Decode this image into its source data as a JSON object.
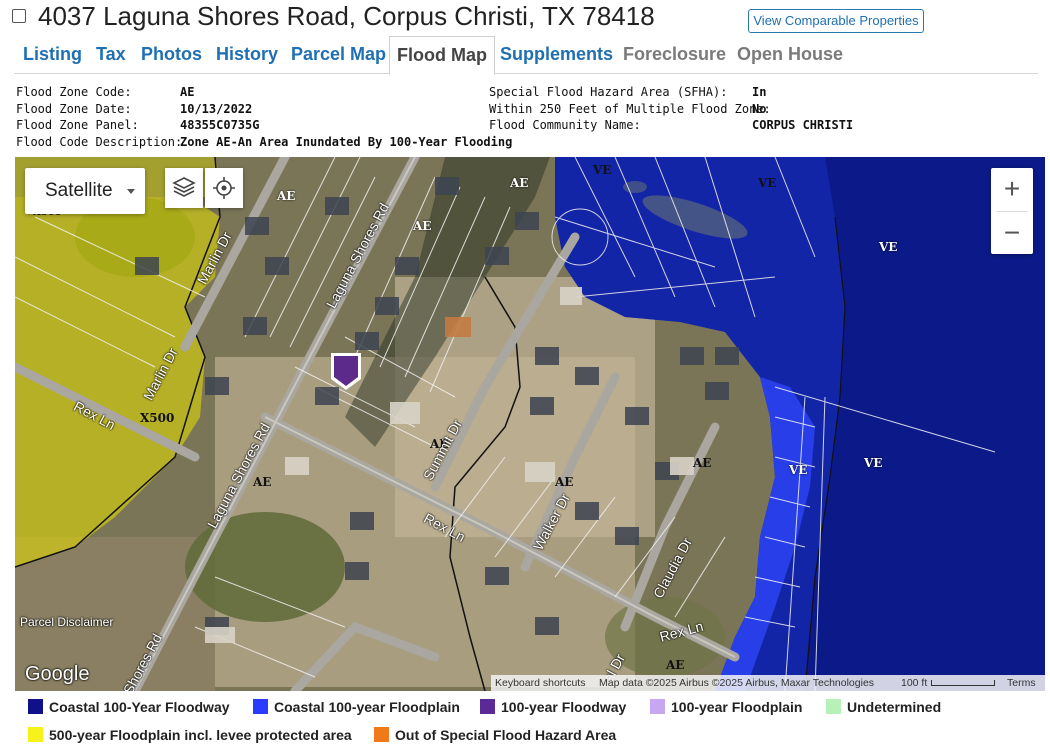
{
  "header": {
    "title": "4037 Laguna Shores Road, Corpus Christi, TX 78418",
    "compare_button": "View Comparable Properties"
  },
  "tabs": [
    {
      "label": "Listing",
      "state": "link"
    },
    {
      "label": "Tax",
      "state": "link"
    },
    {
      "label": "Photos",
      "state": "link"
    },
    {
      "label": "History",
      "state": "link"
    },
    {
      "label": "Parcel Map",
      "state": "link"
    },
    {
      "label": "Flood Map",
      "state": "active"
    },
    {
      "label": "Supplements",
      "state": "link"
    },
    {
      "label": "Foreclosure",
      "state": "disabled"
    },
    {
      "label": "Open House",
      "state": "disabled"
    }
  ],
  "flood_info": {
    "left": [
      {
        "label": "Flood Zone Code:",
        "value": "AE"
      },
      {
        "label": "Flood Zone Date:",
        "value": "10/13/2022"
      },
      {
        "label": "Flood Zone Panel:",
        "value": "48355C0735G"
      },
      {
        "label": "Flood Code Description:",
        "value": "Zone AE-An Area Inundated By 100-Year Flooding"
      }
    ],
    "right": [
      {
        "label": "Special Flood Hazard Area (SFHA):",
        "value": "In"
      },
      {
        "label": "Within 250 Feet of Multiple Flood Zone:",
        "value": "No"
      },
      {
        "label": "Flood Community Name:",
        "value": "CORPUS CHRISTI"
      }
    ]
  },
  "map": {
    "map_type": "Satellite",
    "zoom_in": "+",
    "zoom_out": "−",
    "zone_labels": [
      "AE",
      "AE",
      "AE",
      "AE",
      "AE",
      "AE",
      "AE",
      "AE",
      "AE",
      "VE",
      "VE",
      "VE",
      "VE",
      "VE",
      "X500",
      "X500"
    ],
    "roads": [
      "Laguna Shores Rd",
      "Laguna Shores Rd",
      "Shores Rd",
      "Marlin Dr",
      "Marlin Dr",
      "Rex Ln",
      "Rex Ln",
      "Rex Ln",
      "Summit Dr",
      "Walker Dr",
      "Claudia Dr",
      "al Dr"
    ],
    "disclaimer": "Parcel Disclaimer",
    "google_logo": "Google",
    "attribution": {
      "shortcuts": "Keyboard shortcuts",
      "data": "Map data ©2025 Airbus ©2025 Airbus, Maxar Technologies",
      "scale": "100 ft",
      "terms": "Terms"
    },
    "icons": [
      "map-type-caret-icon",
      "layers-icon",
      "locate-icon",
      "property-marker-icon"
    ]
  },
  "legend": [
    {
      "label": "Coastal 100-Year Floodway",
      "color": "#10108a"
    },
    {
      "label": "Coastal 100-year Floodplain",
      "color": "#2a3cff"
    },
    {
      "label": "100-year Floodway",
      "color": "#5b2a96"
    },
    {
      "label": "100-year Floodplain",
      "color": "#c7a6f2"
    },
    {
      "label": "Undetermined",
      "color": "#b6f2b8"
    },
    {
      "label": "500-year Floodplain incl. levee protected area",
      "color": "#f7f21a"
    },
    {
      "label": "Out of Special Flood Hazard Area",
      "color": "#f07a1a"
    }
  ]
}
